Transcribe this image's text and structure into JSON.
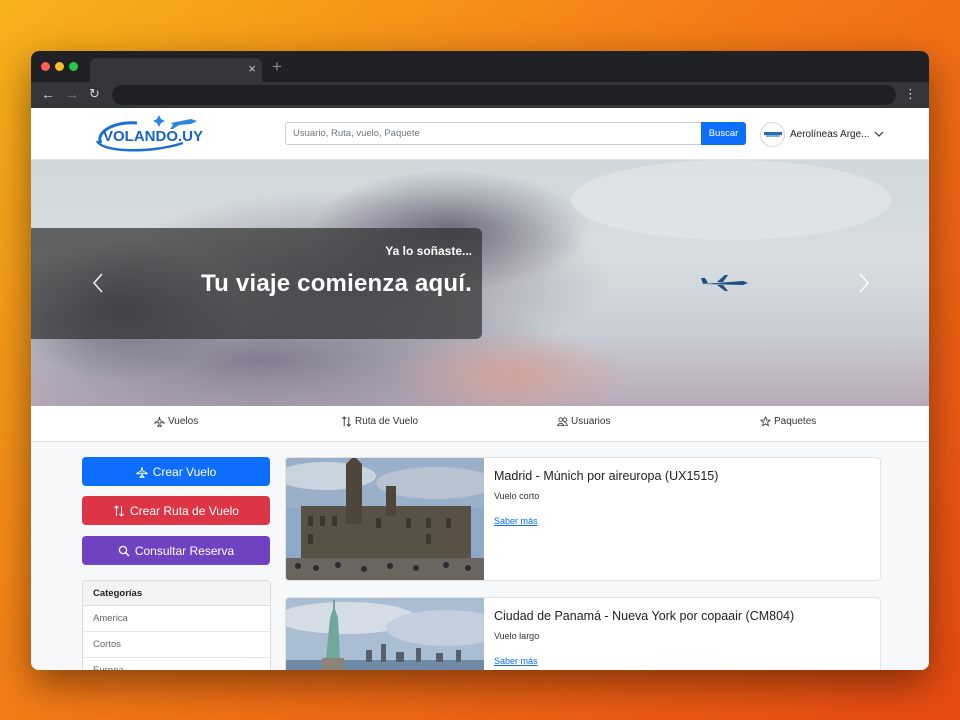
{
  "browser": {
    "tab_close": "×",
    "new_tab": "+",
    "back": "←",
    "forward": "→",
    "reload": "↻",
    "menu": "⋮"
  },
  "header": {
    "logo_text": "VOLANDO.UY",
    "search_placeholder": "Usuario, Ruta, vuelo, Paquete",
    "search_button": "Buscar",
    "user_name": "Aerolíneas Arge..."
  },
  "hero": {
    "caption_small": "Ya lo soñaste...",
    "caption_big": "Tu viaje comienza aquí."
  },
  "category_nav": {
    "items": [
      {
        "label": "Vuelos",
        "icon": "airplane-icon"
      },
      {
        "label": "Ruta de Vuelo",
        "icon": "swap-arrows-icon"
      },
      {
        "label": "Usuarios",
        "icon": "people-icon"
      },
      {
        "label": "Paquetes",
        "icon": "star-icon"
      }
    ]
  },
  "sidebar": {
    "buttons": [
      {
        "label": "Crear Vuelo",
        "icon": "airplane-icon"
      },
      {
        "label": "Crear Ruta de Vuelo",
        "icon": "swap-arrows-icon"
      },
      {
        "label": "Consultar Reserva",
        "icon": "search-icon"
      }
    ],
    "categories_title": "Categorías",
    "categories": [
      "America",
      "Cortos",
      "Europa"
    ]
  },
  "cards": [
    {
      "title": "Madrid - Múnich por aireuropa (UX1515)",
      "subtitle": "Vuelo corto",
      "link": "Saber más"
    },
    {
      "title": "Ciudad de Panamá - Nueva York por copaair (CM804)",
      "subtitle": "Vuelo largo",
      "link": "Saber más"
    }
  ],
  "colors": {
    "primary": "#0d6efd",
    "danger": "#dc3545",
    "purple": "#6f42c1"
  }
}
